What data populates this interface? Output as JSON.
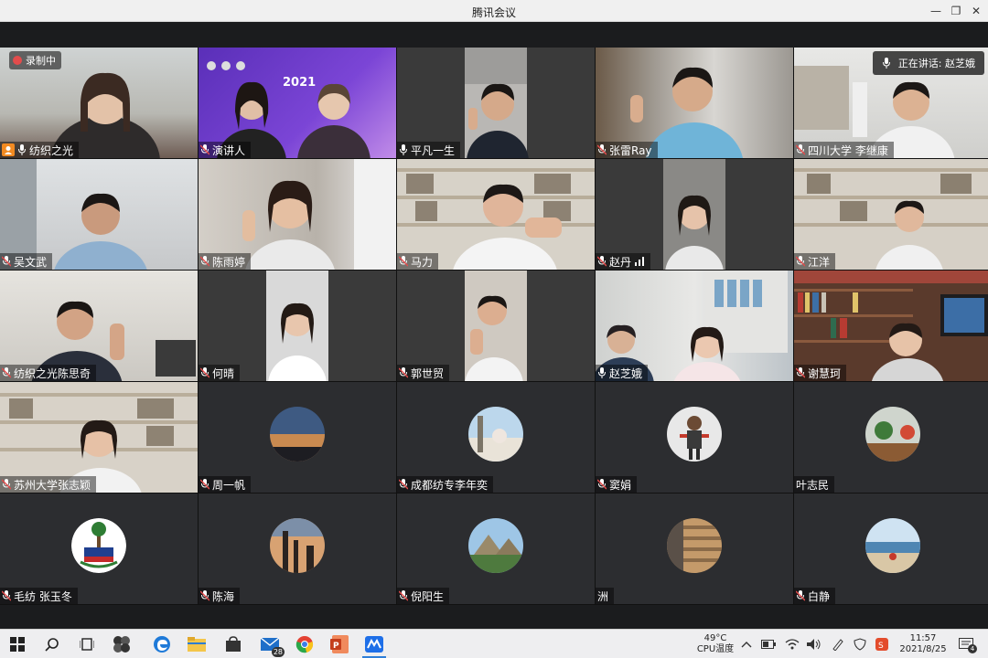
{
  "window": {
    "title": "腾讯会议"
  },
  "recording": {
    "label": "录制中"
  },
  "speaking": {
    "label": "正在讲话: 赵芝娥"
  },
  "participants": [
    {
      "name": "纺织之光",
      "video": true
    },
    {
      "name": "演讲人",
      "video": true
    },
    {
      "name": "平凡一生",
      "video": true
    },
    {
      "name": "张雷Ray",
      "video": true
    },
    {
      "name": "四川大学 李继康",
      "video": true
    },
    {
      "name": "吴文武",
      "video": true
    },
    {
      "name": "陈雨婷",
      "video": true
    },
    {
      "name": "马力",
      "video": true
    },
    {
      "name": "赵丹",
      "video": true
    },
    {
      "name": "江洋",
      "video": true
    },
    {
      "name": "纺织之光陈思奇",
      "video": true
    },
    {
      "name": "何晴",
      "video": true
    },
    {
      "name": "郭世贸",
      "video": true
    },
    {
      "name": "赵芝娥",
      "video": true
    },
    {
      "name": "谢慧珂",
      "video": true
    },
    {
      "name": "苏州大学张志颖",
      "video": true
    },
    {
      "name": "周一帆",
      "video": false,
      "avatar": "sunset-avatar"
    },
    {
      "name": "成都纺专李年奕",
      "video": false,
      "avatar": "seaside-avatar"
    },
    {
      "name": "窦娟",
      "video": false,
      "avatar": "cartoon-avatar"
    },
    {
      "name": "叶志民",
      "video": false,
      "avatar": "plant-avatar"
    },
    {
      "name": "毛纺 张玉冬",
      "video": false,
      "avatar": "emblem-avatar"
    },
    {
      "name": "陈海",
      "video": false,
      "avatar": "skyline-avatar"
    },
    {
      "name": "倪阳生",
      "video": false,
      "avatar": "pyramid-avatar"
    },
    {
      "name": "洲",
      "video": false,
      "avatar": "stairs-avatar"
    },
    {
      "name": "白静",
      "video": false,
      "avatar": "beach-avatar"
    }
  ],
  "slide_banner": {
    "year": "2021"
  },
  "taskbar": {
    "mail_badge": "28",
    "cpu_temp": "49°C",
    "cpu_label": "CPU温度",
    "time": "11:57",
    "date": "2021/8/25",
    "notif_count": "4"
  },
  "colors": {
    "accent": "#f28a21",
    "record": "#e34c4c"
  }
}
